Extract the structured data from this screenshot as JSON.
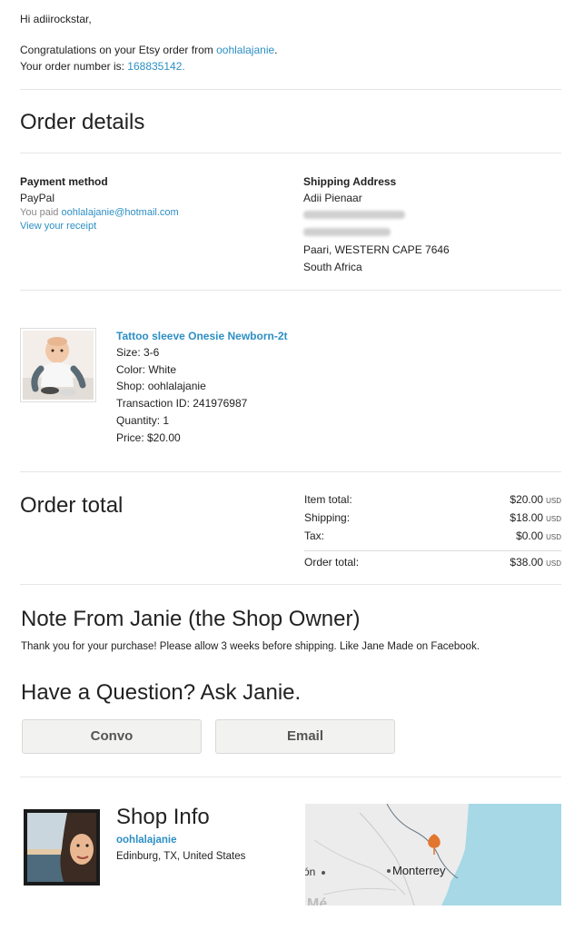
{
  "intro": {
    "greeting": "Hi adiirockstar,",
    "congrats_prefix": "Congratulations on your Etsy order from ",
    "shop_name": "oohlalajanie",
    "congrats_suffix": ".",
    "order_prefix": "Your order number is: ",
    "order_number": "168835142."
  },
  "order_details": {
    "heading": "Order details",
    "payment_label": "Payment method",
    "payment_method": "PayPal",
    "paid_prefix": "You paid ",
    "paid_email": "oohlalajanie@hotmail.com",
    "view_receipt": "View your receipt",
    "shipping_label": "Shipping Address",
    "ship_name": "Adii Pienaar",
    "ship_city": "Paari, WESTERN CAPE 7646",
    "ship_country": "South Africa"
  },
  "item": {
    "title": "Tattoo sleeve Onesie Newborn-2t",
    "size": "Size: 3-6",
    "color": "Color: White",
    "shop": "Shop: oohlalajanie",
    "transaction": "Transaction ID: 241976987",
    "quantity": "Quantity: 1",
    "price": "Price: $20.00"
  },
  "order_total": {
    "heading": "Order total",
    "rows": [
      {
        "label": "Item total:",
        "value": "$20.00",
        "currency": "USD"
      },
      {
        "label": "Shipping:",
        "value": "$18.00",
        "currency": "USD"
      },
      {
        "label": "Tax:",
        "value": "$0.00",
        "currency": "USD"
      }
    ],
    "total_label": "Order total:",
    "total_value": "$38.00",
    "total_currency": "USD"
  },
  "note": {
    "heading": "Note From Janie (the Shop Owner)",
    "text": "Thank you for your purchase! Please allow 3 weeks before shipping. Like Jane Made on Facebook."
  },
  "question": {
    "heading": "Have a Question? Ask Janie.",
    "convo_label": "Convo",
    "email_label": "Email"
  },
  "shop_info": {
    "heading": "Shop Info",
    "shop_name": "oohlalajanie",
    "location": "Edinburg, TX, United States",
    "map_label": "Monterrey",
    "map_partial_label": "ón",
    "map_bottom_label": "Mé"
  },
  "colors": {
    "link": "#2d8fc4",
    "map_water": "#a6d8e6",
    "map_land": "#ececec",
    "pin": "#e3762f"
  }
}
